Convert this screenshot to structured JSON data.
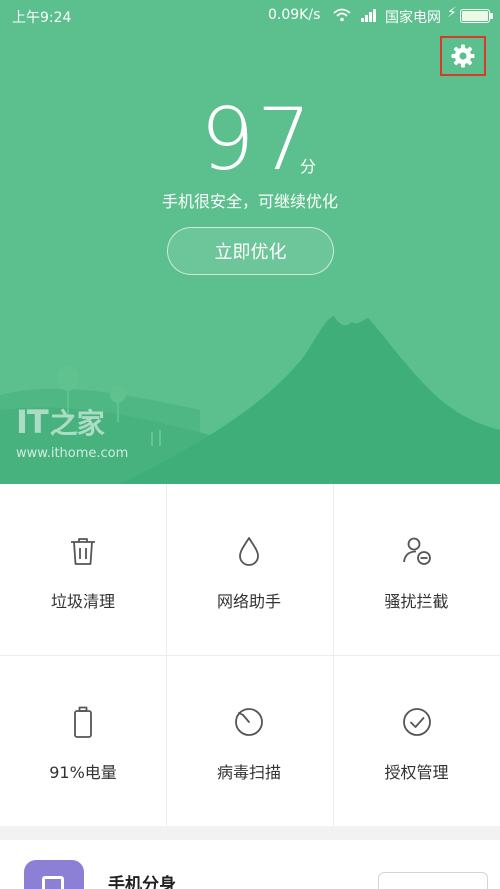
{
  "status_bar": {
    "time": "上午9:24",
    "speed": "0.09K/s",
    "carrier": "国家电网",
    "icons": [
      "wifi-icon",
      "signal-icon",
      "charging-bolt-icon",
      "battery-icon"
    ]
  },
  "header": {
    "settings_icon": "gear-icon"
  },
  "score": {
    "value": "97",
    "unit": "分"
  },
  "status_text": "手机很安全，可继续优化",
  "optimize_button": "立即优化",
  "watermark": {
    "logo": "IT",
    "logo_cn": "之家",
    "url": "www.ithome.com"
  },
  "tools": [
    {
      "label": "垃圾清理",
      "icon": "trash-icon"
    },
    {
      "label": "网络助手",
      "icon": "water-drop-icon"
    },
    {
      "label": "骚扰拦截",
      "icon": "user-block-icon"
    },
    {
      "label": "91%电量",
      "icon": "battery-icon"
    },
    {
      "label": "病毒扫描",
      "icon": "scan-timer-icon"
    },
    {
      "label": "授权管理",
      "icon": "check-circle-icon"
    }
  ],
  "card": {
    "title": "手机分身",
    "icon": "app-clone-icon"
  },
  "colors": {
    "hero_green": "#5cc08e",
    "mountain_green": "#3fae78",
    "highlight_red": "#d63a2a"
  }
}
